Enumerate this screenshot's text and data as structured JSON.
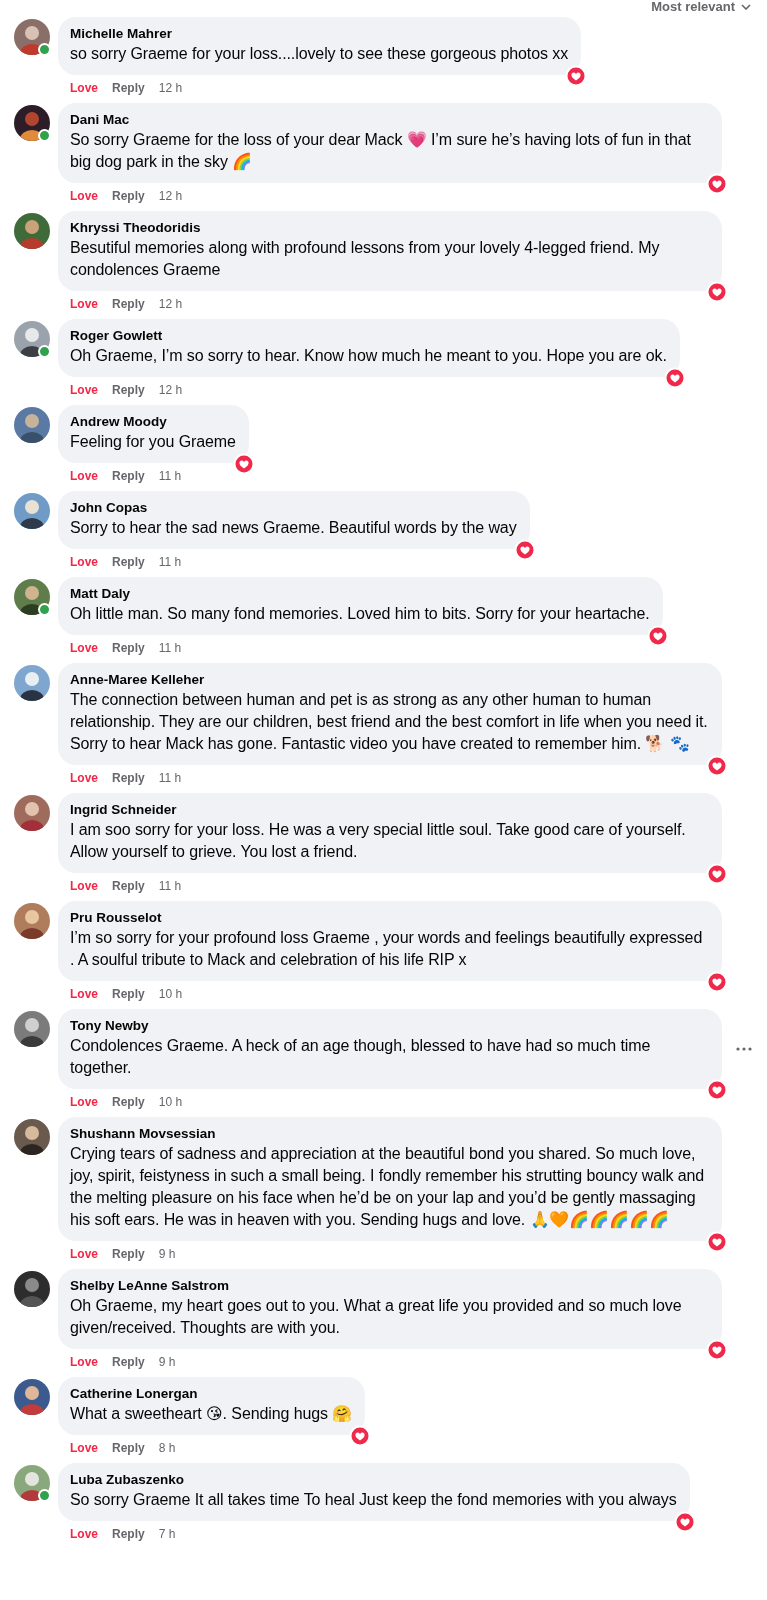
{
  "sort": {
    "label": "Most relevant"
  },
  "comments": [
    {
      "name": "Michelle Mahrer",
      "text": "so sorry Graeme for your loss....lovely to see these gorgeous photos xx",
      "online": true,
      "liked": true,
      "reacted": true,
      "more": false,
      "like_label": "Love",
      "reply_label": "Reply",
      "time": "12 h"
    },
    {
      "name": "Dani Mac",
      "text": "So sorry Graeme for the loss of your dear Mack 💗 I’m sure he’s having lots of fun in that big dog park in the sky 🌈",
      "online": true,
      "liked": true,
      "reacted": true,
      "more": false,
      "like_label": "Love",
      "reply_label": "Reply",
      "time": "12 h"
    },
    {
      "name": "Khryssi Theodoridis",
      "text": "Besutiful memories along with profound lessons from your lovely 4-legged friend. My condolences Graeme",
      "online": false,
      "liked": true,
      "reacted": true,
      "more": false,
      "like_label": "Love",
      "reply_label": "Reply",
      "time": "12 h"
    },
    {
      "name": "Roger Gowlett",
      "text": "Oh Graeme, I’m so sorry to hear. Know how much he meant to you. Hope you are ok.",
      "online": true,
      "liked": true,
      "reacted": true,
      "more": false,
      "like_label": "Love",
      "reply_label": "Reply",
      "time": "12 h"
    },
    {
      "name": "Andrew Moody",
      "text": "Feeling for you Graeme",
      "online": false,
      "liked": true,
      "reacted": true,
      "more": false,
      "like_label": "Love",
      "reply_label": "Reply",
      "time": "11 h"
    },
    {
      "name": "John Copas",
      "text": "Sorry to hear the sad news Graeme. Beautiful words by the way",
      "online": false,
      "liked": true,
      "reacted": true,
      "more": false,
      "like_label": "Love",
      "reply_label": "Reply",
      "time": "11 h"
    },
    {
      "name": "Matt Daly",
      "text": "Oh little man. So many fond memories. Loved him to bits. Sorry for your heartache.",
      "online": true,
      "liked": true,
      "reacted": true,
      "more": false,
      "like_label": "Love",
      "reply_label": "Reply",
      "time": "11 h"
    },
    {
      "name": "Anne-Maree Kelleher",
      "text": "The connection between human and pet is as strong as any other human to human relationship. They are our children, best friend and the best comfort in life when you need it. Sorry to hear Mack has gone. Fantastic video you have created to remember him. 🐕 🐾",
      "online": false,
      "liked": true,
      "reacted": true,
      "more": false,
      "like_label": "Love",
      "reply_label": "Reply",
      "time": "11 h"
    },
    {
      "name": "Ingrid Schneider",
      "text": "I am soo sorry for your loss. He was a very special little soul. Take good care of yourself. Allow yourself to grieve. You lost a friend.",
      "online": false,
      "liked": true,
      "reacted": true,
      "more": false,
      "like_label": "Love",
      "reply_label": "Reply",
      "time": "11 h"
    },
    {
      "name": "Pru Rousselot",
      "text": "I’m so sorry for your profound loss Graeme , your words and feelings beautifully expressed . A soulful tribute to Mack and celebration of his life RIP x",
      "online": false,
      "liked": true,
      "reacted": true,
      "more": false,
      "like_label": "Love",
      "reply_label": "Reply",
      "time": "10 h"
    },
    {
      "name": "Tony Newby",
      "text": "Condolences Graeme. A heck of an age though, blessed to have had so much time together.",
      "online": false,
      "liked": true,
      "reacted": true,
      "more": true,
      "like_label": "Love",
      "reply_label": "Reply",
      "time": "10 h"
    },
    {
      "name": "Shushann Movsessian",
      "text": "Crying tears of sadness and appreciation at the beautiful bond you shared. So much love, joy, spirit, feistyness in such a small being. I fondly remember his strutting bouncy walk and the melting pleasure on his face when he’d be on your lap and you’d be gently massaging his soft ears. He was in heaven with you. Sending hugs and love. 🙏🧡🌈🌈🌈🌈🌈",
      "online": false,
      "liked": true,
      "reacted": true,
      "more": false,
      "like_label": "Love",
      "reply_label": "Reply",
      "time": "9 h"
    },
    {
      "name": "Shelby LeAnne Salstrom",
      "text": "Oh Graeme, my heart goes out to you. What a great life you provided and so much love given/received. Thoughts are with you.",
      "online": false,
      "liked": true,
      "reacted": true,
      "more": false,
      "like_label": "Love",
      "reply_label": "Reply",
      "time": "9 h"
    },
    {
      "name": "Catherine Lonergan",
      "text": "What a sweetheart 😘. Sending hugs 🤗",
      "online": false,
      "liked": true,
      "reacted": true,
      "more": false,
      "like_label": "Love",
      "reply_label": "Reply",
      "time": "8 h"
    },
    {
      "name": "Luba Zubaszenko",
      "text": "So sorry Graeme It all takes time To heal Just keep the fond memories with you always",
      "online": true,
      "liked": true,
      "reacted": true,
      "more": false,
      "like_label": "Love",
      "reply_label": "Reply",
      "time": "7 h"
    }
  ]
}
